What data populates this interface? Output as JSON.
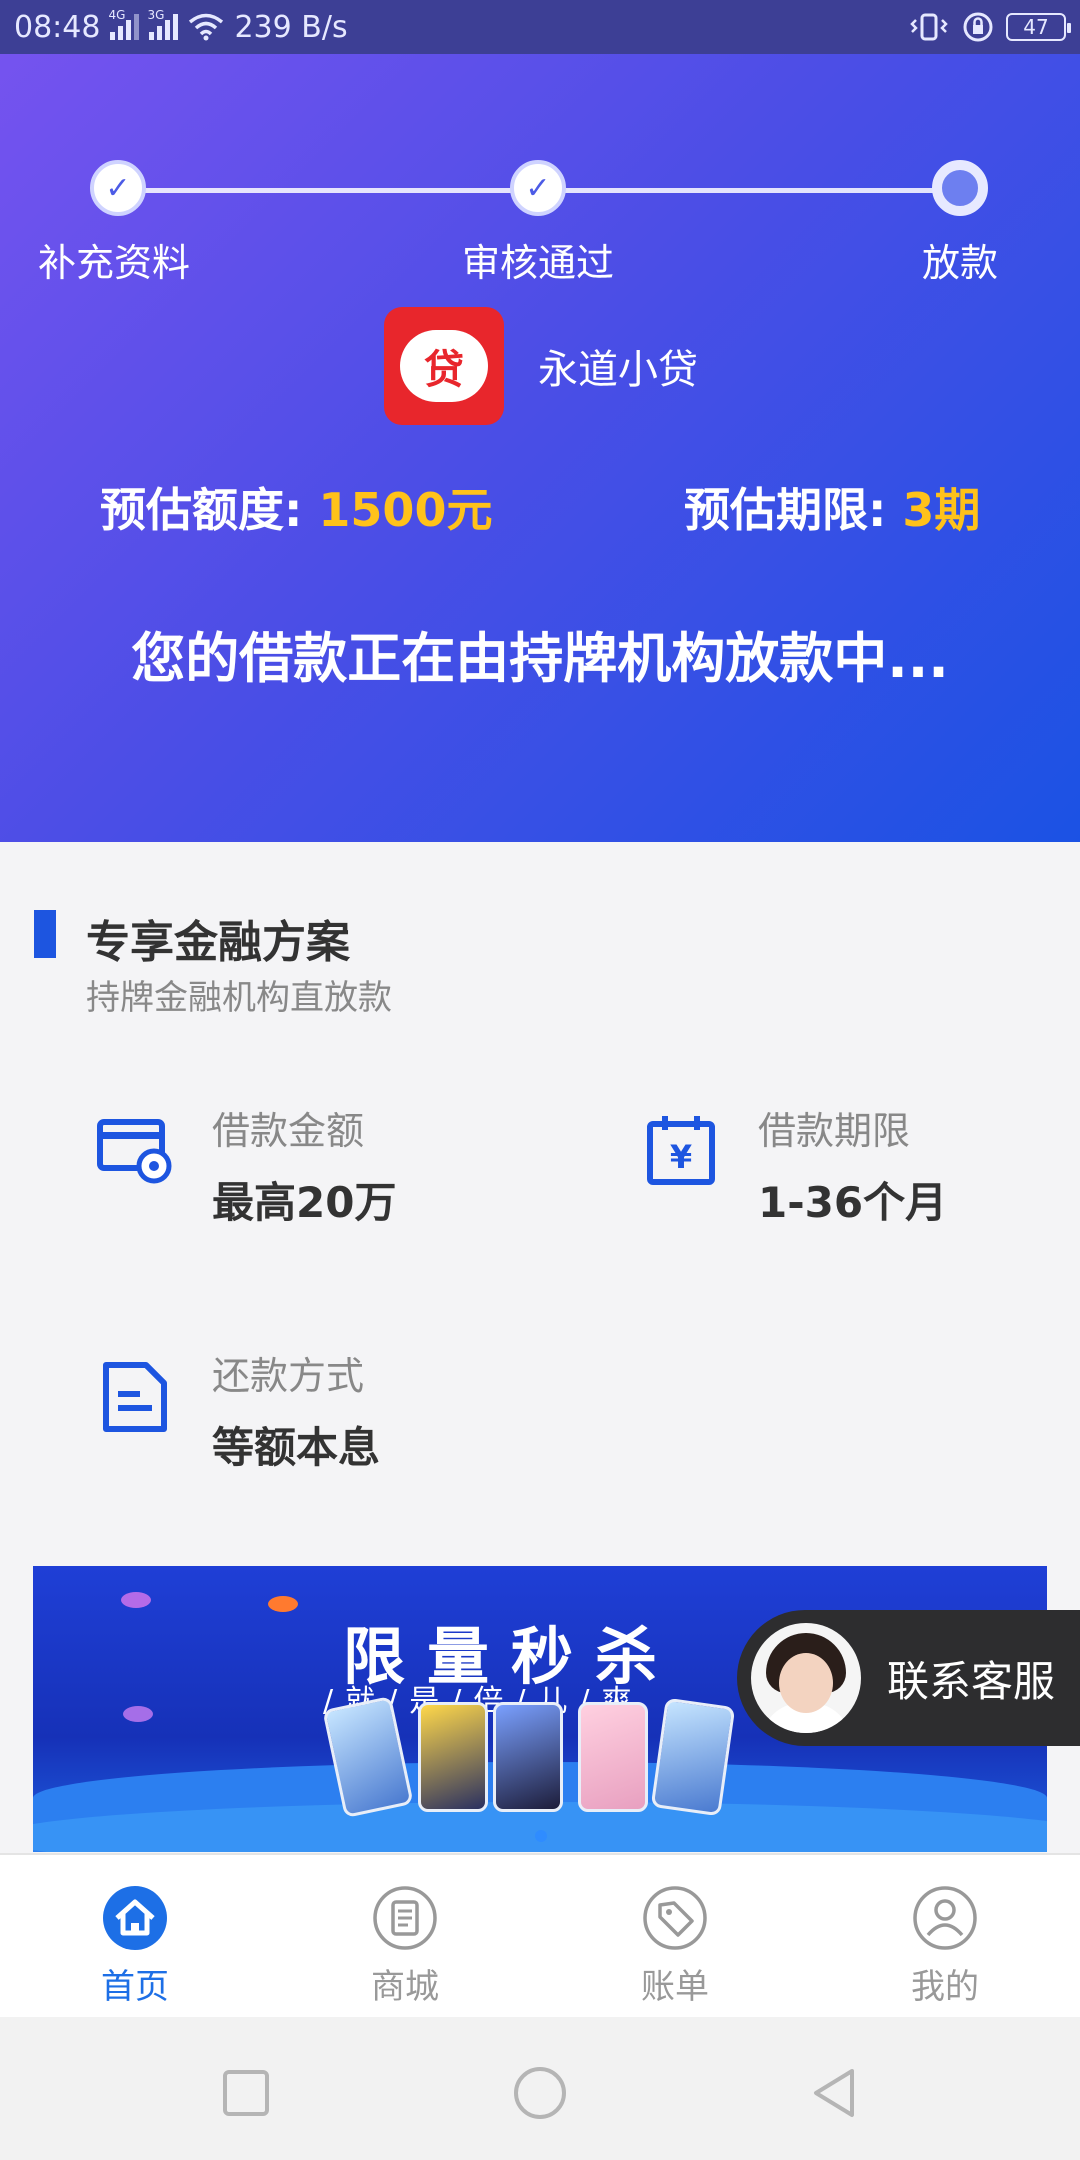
{
  "status_bar": {
    "time": "08:48",
    "network_1": "4G",
    "network_2": "3G",
    "speed": "239 B/s",
    "battery": "47",
    "icons": [
      "signal-icon",
      "wifi-icon",
      "vibrate-icon",
      "rotation-lock-icon",
      "battery-icon"
    ]
  },
  "progress": {
    "steps": [
      {
        "label": "补充资料",
        "state": "done"
      },
      {
        "label": "审核通过",
        "state": "done"
      },
      {
        "label": "放款",
        "state": "current"
      }
    ]
  },
  "lender": {
    "logo_text": "贷",
    "name": "永道小贷"
  },
  "estimates": {
    "amount_label": "预估额度:",
    "amount_value": "1500元",
    "term_label": "预估期限:",
    "term_value": "3期"
  },
  "status_message": "您的借款正在由持牌机构放款中...",
  "section": {
    "title": "专享金融方案",
    "subtitle": "持牌金融机构直放款",
    "features": [
      {
        "label": "借款金额",
        "value": "最高20万",
        "icon": "card-icon"
      },
      {
        "label": "借款期限",
        "value": "1-36个月",
        "icon": "calendar-yen-icon"
      },
      {
        "label": "还款方式",
        "value": "等额本息",
        "icon": "document-icon"
      }
    ]
  },
  "banner": {
    "title": "限量秒杀",
    "subtitle": "/就/是/倍/儿/爽"
  },
  "customer_service": {
    "label": "联系客服"
  },
  "tabbar": {
    "tabs": [
      {
        "label": "首页",
        "icon": "home-icon",
        "active": true
      },
      {
        "label": "商城",
        "icon": "store-icon",
        "active": false
      },
      {
        "label": "账单",
        "icon": "tag-icon",
        "active": false
      },
      {
        "label": "我的",
        "icon": "user-icon",
        "active": false
      }
    ]
  },
  "colors": {
    "accent": "#1d55e0",
    "highlight": "#ffc21a",
    "tab_active": "#1d6fe6"
  }
}
